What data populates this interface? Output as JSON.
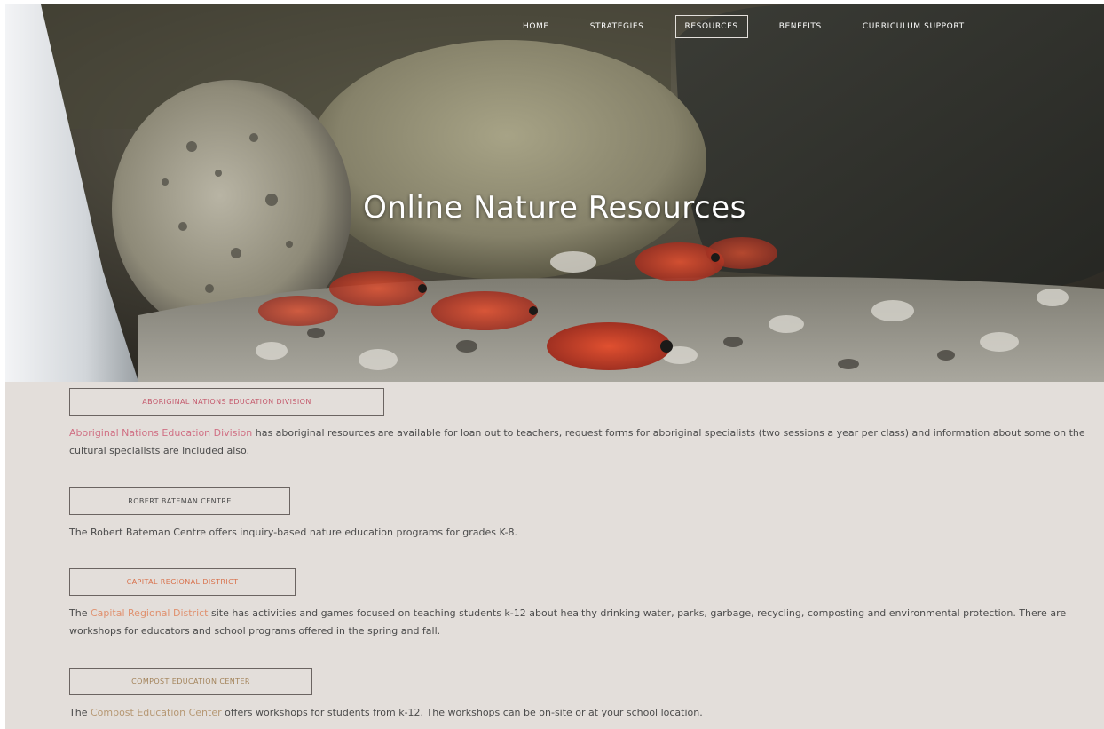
{
  "nav": {
    "items": [
      {
        "label": "HOME"
      },
      {
        "label": "STRATEGIES"
      },
      {
        "label": "RESOURCES"
      },
      {
        "label": "BENEFITS"
      },
      {
        "label": "CURRICULUM SUPPORT"
      }
    ],
    "active": "RESOURCES"
  },
  "hero": {
    "title": "Online Nature Resources"
  },
  "sections": [
    {
      "tag": "ABORIGINAL NATIONS EDUCATION DIVISION",
      "pre": "",
      "link": "Aboriginal Nations Education Division",
      "post": " has aboriginal resources are available for loan out to teachers, request forms for aboriginal specialists (two sessions a year per class) and information about some on the cultural specialists are included also."
    },
    {
      "tag": "ROBERT BATEMAN CENTRE",
      "text": "The Robert Bateman Centre  offers inquiry-based nature education programs for grades K-8."
    },
    {
      "tag": "CAPITAL REGIONAL DISTRICT",
      "pre": "The ",
      "link": "Capital Regional District",
      "post": " site has activities and games focused on teaching students k-12 about healthy drinking water, parks, garbage, recycling, composting and environmental protection. There are workshops for educators and school programs offered in the spring and fall."
    },
    {
      "tag": "COMPOST EDUCATION CENTER",
      "pre": "The ",
      "link": "Compost Education Center",
      "post": " offers workshops for students from k-12. The workshops can be on-site or at your school location."
    }
  ],
  "colors": {
    "content_bg": "#e3deda",
    "link_red": "#d07084",
    "link_orange": "#e0916f",
    "link_tan": "#b69874",
    "nav_text": "#ffffff"
  }
}
